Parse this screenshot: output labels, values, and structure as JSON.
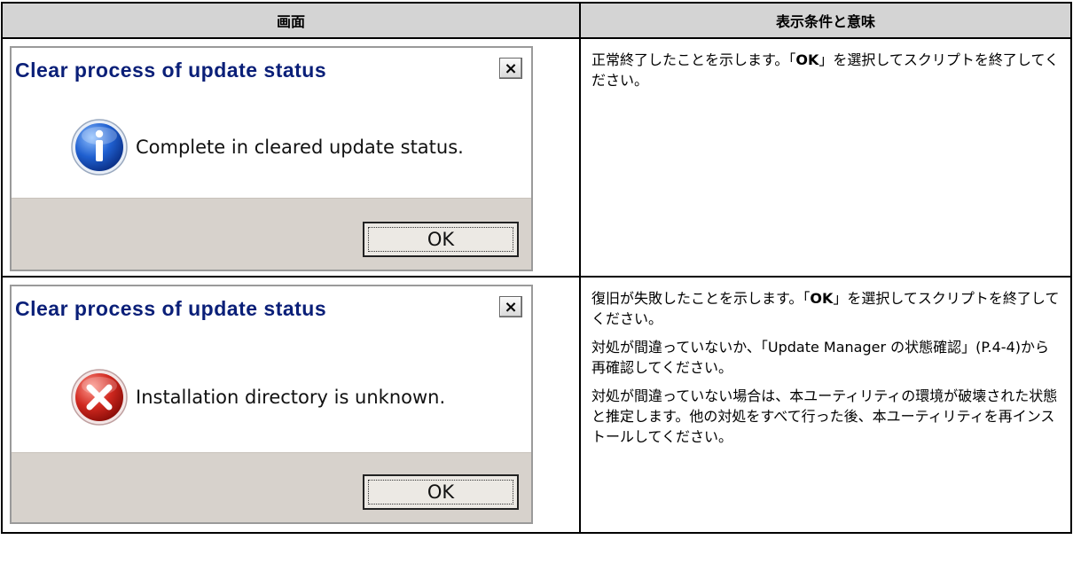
{
  "table": {
    "header_screen": "画面",
    "header_meaning": "表示条件と意味"
  },
  "rows": [
    {
      "dialog": {
        "title": "Clear process of update status",
        "close_symbol": "×",
        "icon": "information-icon",
        "message": "Complete in cleared update status.",
        "ok_label": "OK"
      },
      "description": {
        "p1_before": "正常終了したことを示します。「",
        "p1_bold": "OK",
        "p1_after": "」を選択してスクリプトを終了してください。"
      }
    },
    {
      "dialog": {
        "title": "Clear process of update status",
        "close_symbol": "×",
        "icon": "error-icon",
        "message": "Installation directory is unknown.",
        "ok_label": "OK"
      },
      "description": {
        "p1_before": "復旧が失敗したことを示します。「",
        "p1_bold": "OK",
        "p1_after": "」を選択してスクリプトを終了してください。",
        "p2": "対処が間違っていないか、「Update Manager の状態確認」(P.4-4)から再確認してください。",
        "p3": "対処が間違っていない場合は、本ユーティリティの環境が破壊された状態と推定します。他の対処をすべて行った後、本ユーティリティを再インストールしてください。"
      }
    }
  ]
}
